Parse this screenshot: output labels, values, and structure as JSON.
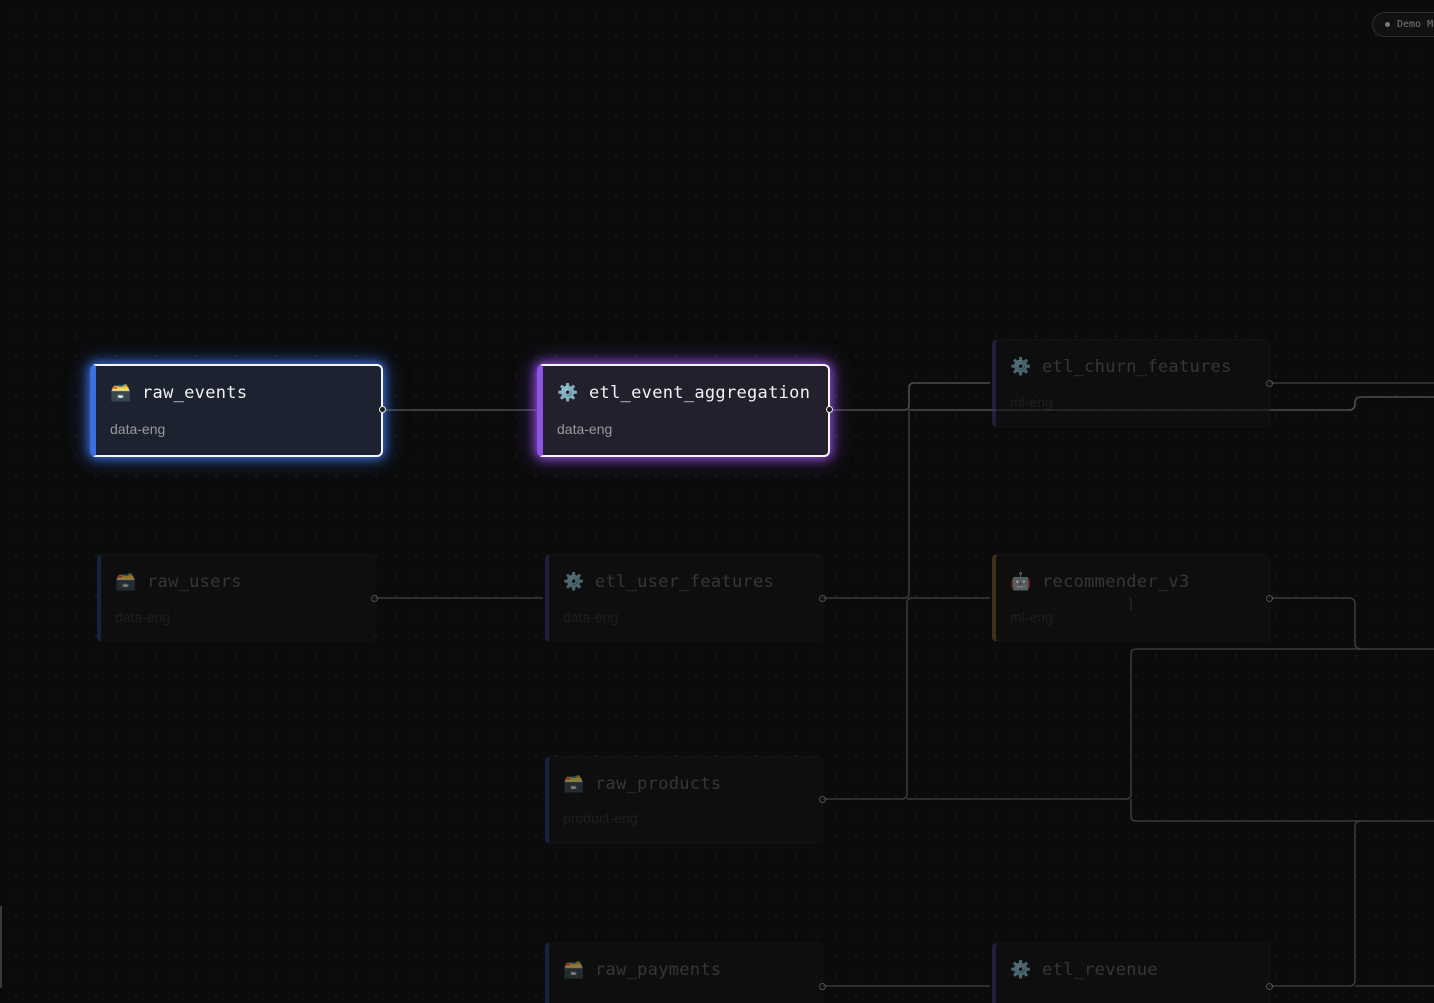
{
  "mode_badge": {
    "label": "Demo M"
  },
  "nodes": [
    {
      "id": "raw_events",
      "title": "raw_events",
      "owner": "data-eng",
      "icon": "🗃️",
      "icon_name": "database-icon",
      "kind": "source",
      "state": "selected",
      "accent": "#3a6fe0"
    },
    {
      "id": "etl_event_aggregation",
      "title": "etl_event_aggregation",
      "owner": "data-eng",
      "icon": "⚙️",
      "icon_name": "gear-icon",
      "kind": "transform",
      "state": "selected",
      "accent": "#8d52e6"
    },
    {
      "id": "etl_churn_features",
      "title": "etl_churn_features",
      "owner": "ml-eng",
      "icon": "⚙️",
      "icon_name": "gear-icon",
      "kind": "transform",
      "state": "dimmed"
    },
    {
      "id": "raw_users",
      "title": "raw_users",
      "owner": "data-eng",
      "icon": "🗃️",
      "icon_name": "database-icon",
      "kind": "source",
      "state": "dimmed"
    },
    {
      "id": "etl_user_features",
      "title": "etl_user_features",
      "owner": "data-eng",
      "icon": "⚙️",
      "icon_name": "gear-icon",
      "kind": "transform",
      "state": "dimmed"
    },
    {
      "id": "recommender_v3",
      "title": "recommender_v3",
      "owner": "ml-eng",
      "icon": "🤖",
      "icon_name": "robot-icon",
      "kind": "model",
      "state": "dimmed"
    },
    {
      "id": "raw_products",
      "title": "raw_products",
      "owner": "product-eng",
      "icon": "🗃️",
      "icon_name": "database-icon",
      "kind": "source",
      "state": "dimmed"
    },
    {
      "id": "raw_payments",
      "title": "raw_payments",
      "owner": "",
      "icon": "🗃️",
      "icon_name": "database-icon",
      "kind": "source",
      "state": "dimmed"
    },
    {
      "id": "etl_revenue",
      "title": "etl_revenue",
      "owner": "",
      "icon": "⚙️",
      "icon_name": "gear-icon",
      "kind": "transform",
      "state": "dimmed"
    }
  ],
  "edges": [
    {
      "from": "raw_events",
      "to": "etl_event_aggregation",
      "highlighted": true
    },
    {
      "from": "etl_event_aggregation",
      "to": "etl_churn_features",
      "highlighted": true
    },
    {
      "from": "raw_users",
      "to": "etl_user_features",
      "highlighted": false
    },
    {
      "from": "etl_user_features",
      "to": "etl_churn_features",
      "highlighted": false
    },
    {
      "from": "etl_user_features",
      "to": "recommender_v3",
      "highlighted": false
    },
    {
      "from": "raw_products",
      "to": "recommender_v3",
      "highlighted": false
    },
    {
      "from": "raw_payments",
      "to": "etl_revenue",
      "highlighted": false
    }
  ]
}
